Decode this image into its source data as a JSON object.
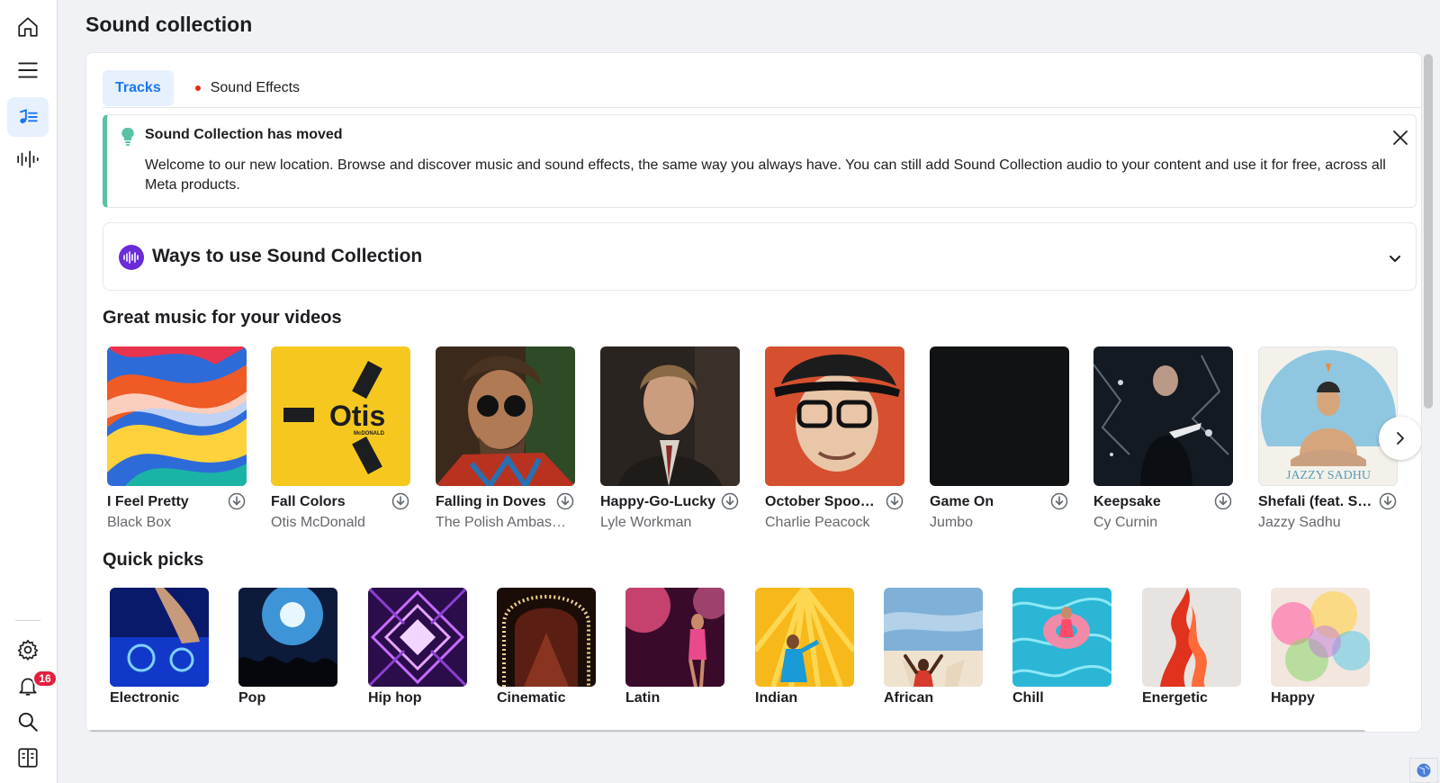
{
  "page": {
    "title": "Sound collection"
  },
  "nav": {
    "items": [
      {
        "icon": "home-icon"
      },
      {
        "icon": "menu-icon"
      },
      {
        "icon": "sound-collection-icon",
        "active": true
      },
      {
        "icon": "audio-waveform-icon"
      }
    ],
    "bottom": [
      {
        "icon": "settings-icon"
      },
      {
        "icon": "notifications-icon",
        "badge": "16"
      },
      {
        "icon": "search-icon"
      },
      {
        "icon": "panel-toggle-icon"
      }
    ]
  },
  "tabs": [
    {
      "label": "Tracks",
      "active": true
    },
    {
      "label": "Sound Effects",
      "active": false,
      "dot": true
    }
  ],
  "notice": {
    "title": "Sound Collection has moved",
    "body": "Welcome to our new location. Browse and discover music and sound effects, the same way you always have. You can still add Sound Collection audio to your content and use it for free, across all Meta products."
  },
  "ways": {
    "title": "Ways to use Sound Collection"
  },
  "tracks_section": {
    "title": "Great music for your videos",
    "items": [
      {
        "title": "I Feel Pretty",
        "artist": "Black Box"
      },
      {
        "title": "Fall Colors",
        "artist": "Otis McDonald"
      },
      {
        "title": "Falling in Doves",
        "artist": "The Polish Ambass…"
      },
      {
        "title": "Happy-Go-Lucky",
        "artist": "Lyle Workman"
      },
      {
        "title": "October Spook…",
        "artist": "Charlie Peacock"
      },
      {
        "title": "Game On",
        "artist": "Jumbo"
      },
      {
        "title": "Keepsake",
        "artist": "Cy Curnin"
      },
      {
        "title": "Shefali (feat. Sr…",
        "artist": "Jazzy Sadhu"
      }
    ],
    "cover_texts": {
      "otis": "Otis",
      "otis_sub": "McDONALD",
      "jazzy": "JAZZY SADHU"
    }
  },
  "quick_picks": {
    "title": "Quick picks",
    "items": [
      {
        "label": "Electronic"
      },
      {
        "label": "Pop"
      },
      {
        "label": "Hip hop"
      },
      {
        "label": "Cinematic"
      },
      {
        "label": "Latin"
      },
      {
        "label": "Indian"
      },
      {
        "label": "African"
      },
      {
        "label": "Chill"
      },
      {
        "label": "Energetic"
      },
      {
        "label": "Happy"
      }
    ]
  },
  "colors": {
    "accent": "#1877f2",
    "notice_border": "#58c1a6",
    "badge": "#e41e3f",
    "tab_dot": "#e02b1f"
  }
}
